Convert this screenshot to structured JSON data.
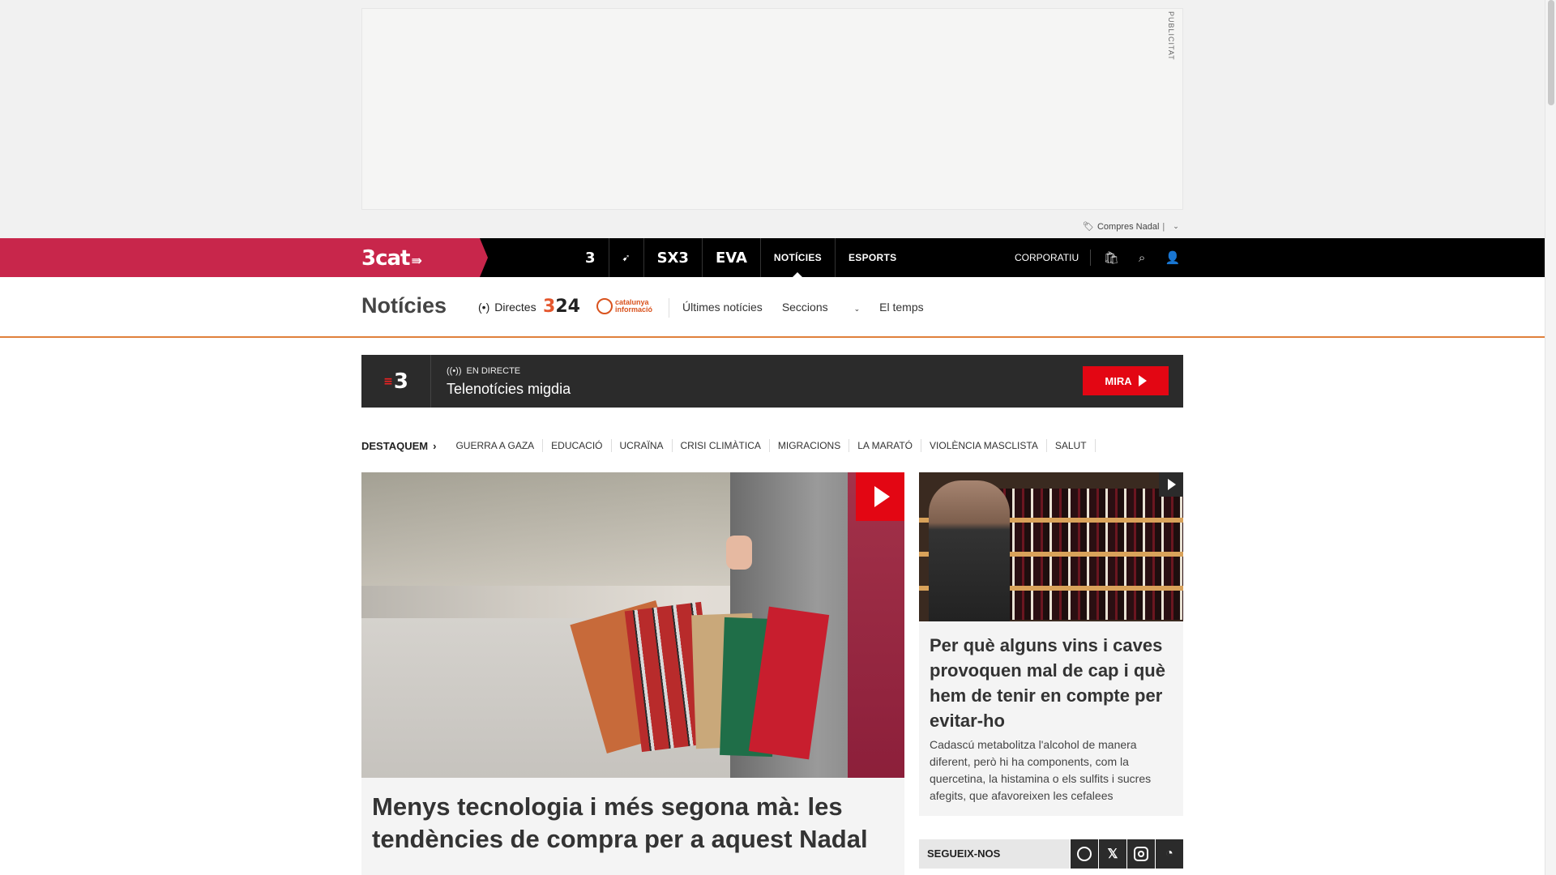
{
  "ad": {
    "label": "PUBLICITAT",
    "tag": "Compres Nadal",
    "tag_sep": "|"
  },
  "topbar": {
    "brand": "3cat",
    "channels": [
      {
        "name": "TV3",
        "label": "3"
      },
      {
        "name": "Catalunya Ràdio",
        "label": "Cat Ràdio"
      },
      {
        "name": "SX3",
        "label": "SX3"
      },
      {
        "name": "EVA",
        "label": "EVA"
      },
      {
        "name": "Notícies",
        "label": "NOTÍCIES"
      },
      {
        "name": "Esports",
        "label": "ESPORTS"
      }
    ],
    "corporatiu": "CORPORATIU",
    "icons": [
      "cart-icon",
      "search-icon",
      "user-icon"
    ]
  },
  "section": {
    "title": "Notícies",
    "directes": "Directes",
    "logo_324": "324",
    "logo_ci": "catalunya informació",
    "nav": [
      "Últimes notícies",
      "Seccions",
      "El temps"
    ]
  },
  "live": {
    "channel": "3",
    "status": "EN DIRECTE",
    "title": "Telenotícies migdia",
    "button": "MIRA"
  },
  "tags": {
    "lead": "DESTAQUEM",
    "items": [
      "GUERRA A GAZA",
      "EDUCACIÓ",
      "UCRAÏNA",
      "CRISI CLIMÀTICA",
      "MIGRACIONS",
      "LA MARATÓ",
      "VIOLÈNCIA MASCLISTA",
      "SALUT"
    ]
  },
  "main_article": {
    "headline": "Menys tecnologia i més segona mà: les tendències de compra per a aquest Nadal",
    "has_video": true
  },
  "side_article": {
    "headline": "Per què alguns vins i caves provoquen mal de cap i què hem de tenir en compte per evitar-ho",
    "summary": "Cadascú metabolitza l'alcohol de manera diferent, però hi ha components, com la quercetina, la histamina o els sulfits i sucres afegits, que afavoreixen les cefalees",
    "has_video": true
  },
  "follow": {
    "label": "SEGUEIX-NOS",
    "networks": [
      "facebook",
      "x",
      "instagram",
      "rss"
    ]
  },
  "colors": {
    "brand": "#c8264b",
    "accent_line": "#e0803b",
    "live_button": "#e30613",
    "topbar": "#000000"
  }
}
